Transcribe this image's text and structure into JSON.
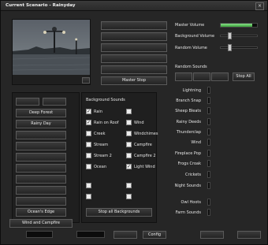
{
  "window": {
    "title": "Current Scenario - Rainyday"
  },
  "preview": {
    "caption": "",
    "corner_label": ""
  },
  "scenario_buttons": [
    "",
    "",
    "",
    "",
    "",
    "Master Stop"
  ],
  "volume": {
    "master_label": "Master Volume",
    "master_level": 0.9,
    "background_label": "Background Volume",
    "background_level": 0.35,
    "random_label": "Random Volume",
    "random_level": 0.35
  },
  "random_sounds": {
    "heading": "Random Sounds",
    "buttons": [
      "",
      "",
      "",
      "Stop All"
    ],
    "items": [
      {
        "label": "Lightning"
      },
      {
        "label": "Branch Snap"
      },
      {
        "label": "Sheep Bleats"
      },
      {
        "label": "Rainy Deeds"
      },
      {
        "label": "Thunderclap"
      },
      {
        "label": "Wind"
      },
      {
        "label": "Fireplace Pop"
      },
      {
        "label": "Frogs Croak"
      },
      {
        "label": "Crickets"
      },
      {
        "label": "Night Sounds"
      },
      {
        "label": "Owl Hoots"
      },
      {
        "label": "Farm Sounds"
      }
    ]
  },
  "background_sounds": {
    "heading": "Background Sounds",
    "left_column": [
      {
        "label": "Rain",
        "checked": true
      },
      {
        "label": "Rain on Roof",
        "checked": true
      },
      {
        "label": "Creek",
        "checked": false
      },
      {
        "label": "Stream",
        "checked": false
      },
      {
        "label": "Stream 2",
        "checked": false
      },
      {
        "label": "Ocean",
        "checked": false
      }
    ],
    "right_column": [
      {
        "label": "",
        "checked": false
      },
      {
        "label": "Wind",
        "checked": false
      },
      {
        "label": "Windchimes",
        "checked": false
      },
      {
        "label": "Campfire",
        "checked": false
      },
      {
        "label": "Campfire 2",
        "checked": false
      },
      {
        "label": "Light Wind",
        "checked": true
      }
    ],
    "extra_left": [
      {
        "label": "",
        "checked": false
      },
      {
        "label": "",
        "checked": false
      }
    ],
    "extra_right": [
      {
        "label": "",
        "checked": false
      },
      {
        "label": "",
        "checked": false
      }
    ],
    "stop_button": "Stop all Backgrounds"
  },
  "scenarios": {
    "top_buttons": [
      "",
      ""
    ],
    "items": [
      "Deep Forest",
      "Rainy Day",
      "",
      "",
      "",
      "",
      "",
      "",
      "",
      "Ocean's Edge",
      "Wind and Campfire"
    ]
  },
  "footer": {
    "time_label": "",
    "time_value": "",
    "pos_label": "",
    "pos_value": "",
    "btn_a": "",
    "btn_b": "Config",
    "btn_c": "",
    "btn_d": ""
  }
}
